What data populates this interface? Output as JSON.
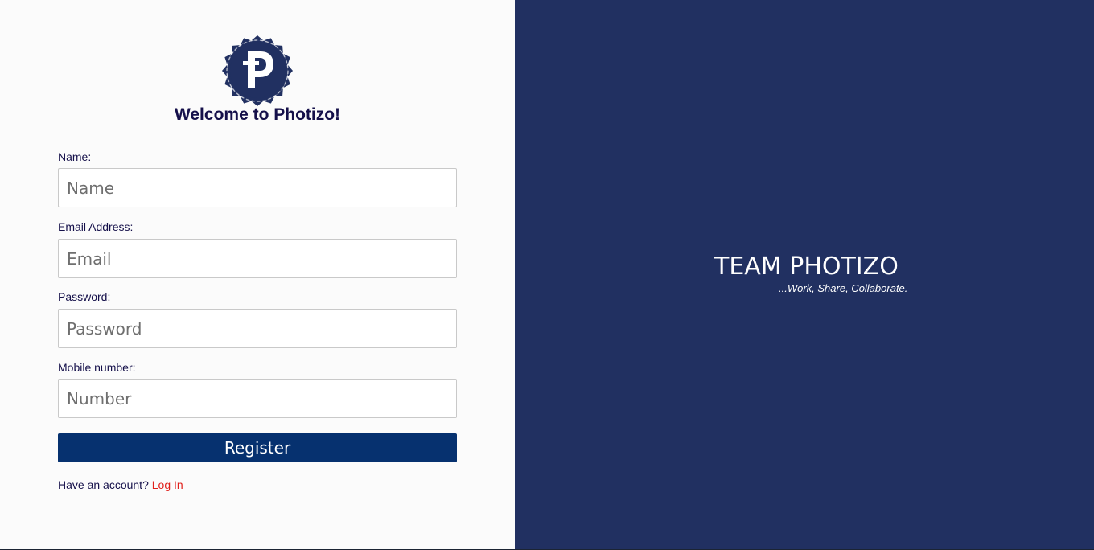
{
  "brand": {
    "logo_icon": "photizo-p-logo-icon",
    "logo_letter": "p",
    "welcome": "Welcome to Photizo!",
    "colors": {
      "primary": "#213061",
      "button": "#06316f",
      "link": "#e0201b",
      "heading": "#15104a"
    }
  },
  "form": {
    "name": {
      "label": "Name:",
      "placeholder": "Name",
      "value": ""
    },
    "email": {
      "label": "Email Address:",
      "placeholder": "Email",
      "value": ""
    },
    "password": {
      "label": "Password:",
      "placeholder": "Password",
      "value": ""
    },
    "mobile": {
      "label": "Mobile number:",
      "placeholder": "Number",
      "value": ""
    },
    "register_label": "Register",
    "account_prompt": "Have an account?",
    "login_label": "Log In"
  },
  "hero": {
    "title": "TEAM PHOTIZO",
    "tagline": "...Work, Share, Collaborate."
  }
}
